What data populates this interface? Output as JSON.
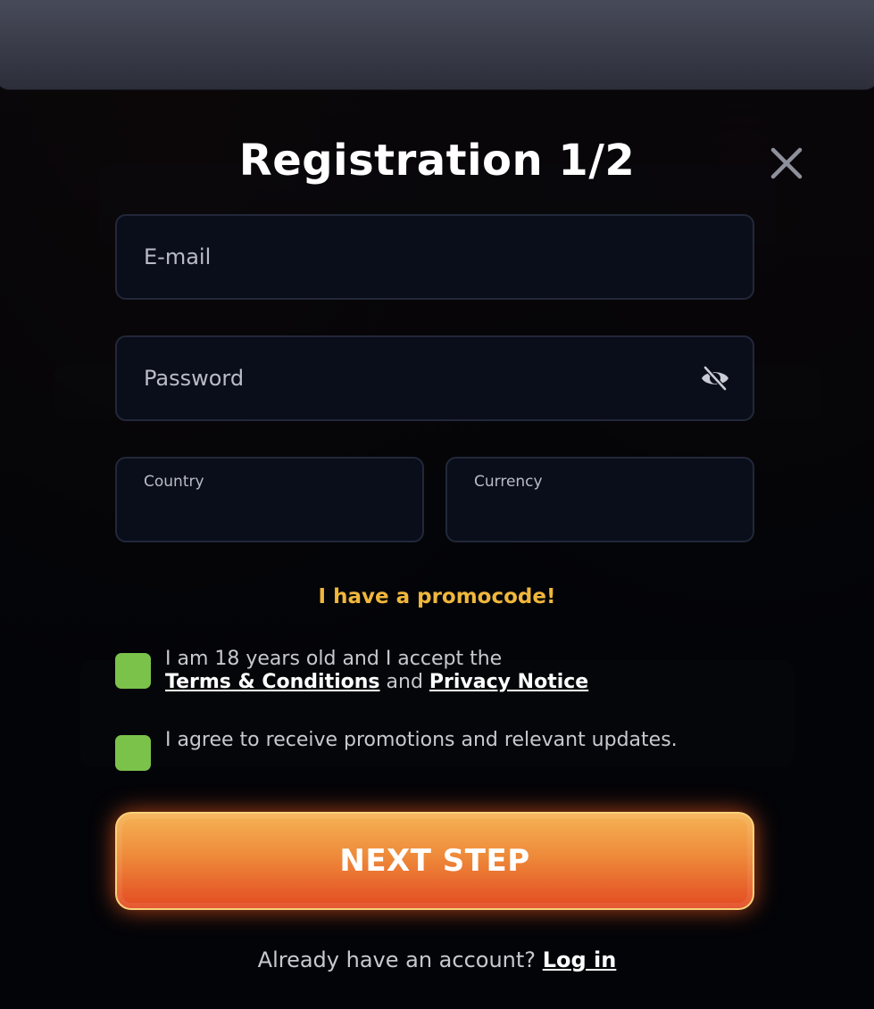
{
  "modal": {
    "title": "Registration 1/2",
    "close_icon": "close-icon"
  },
  "form": {
    "email_placeholder": "E-mail",
    "password_placeholder": "Password",
    "password_toggle_icon": "eye-off-icon",
    "country_label": "Country",
    "currency_label": "Currency",
    "promo_link": "I have a promocode!"
  },
  "consents": {
    "age": {
      "text_before": "I am 18 years old and I accept the",
      "terms_link": "Terms & Conditions",
      "and": "and",
      "privacy_link": "Privacy Notice",
      "checked": true
    },
    "promotions": {
      "text": "I agree to receive promotions and relevant updates.",
      "checked": true
    }
  },
  "actions": {
    "next_step_label": "NEXT STEP",
    "have_account_text": "Already have an account?",
    "login_link": "Log in"
  },
  "colors": {
    "accent_promo": "#f0b73c",
    "checkbox": "#7bc24b",
    "button_top": "#f6b355",
    "button_bottom": "#e34a22",
    "field_bg": "#0a0e1a"
  }
}
